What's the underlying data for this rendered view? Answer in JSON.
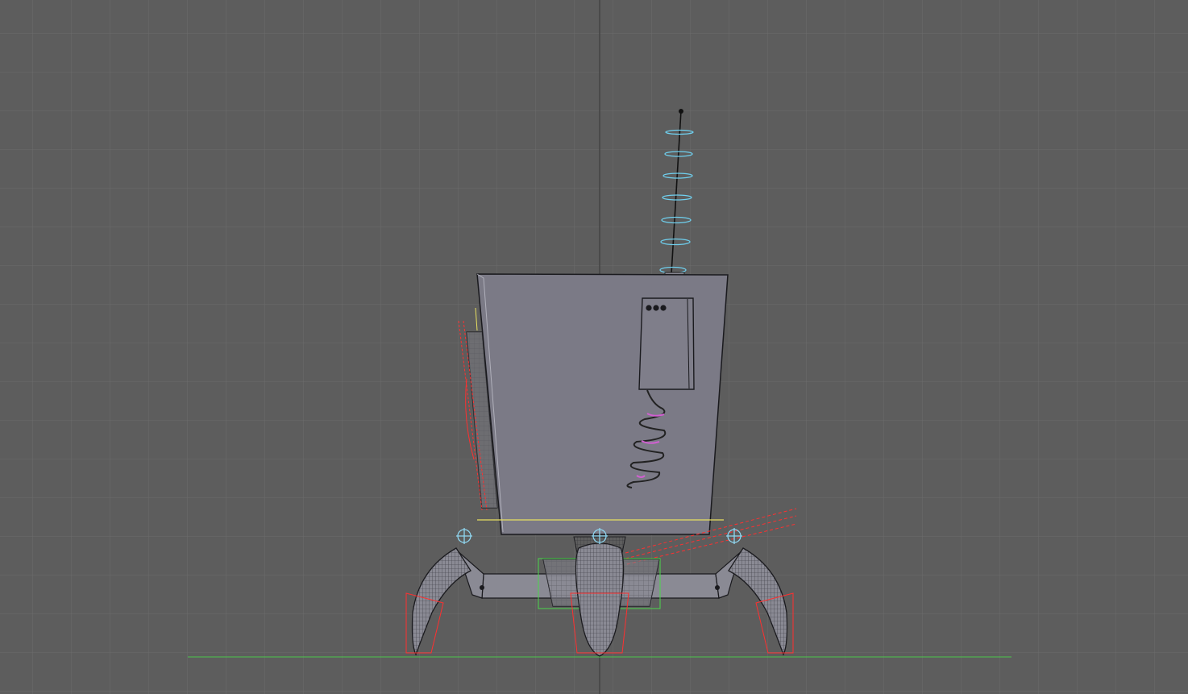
{
  "viewport": {
    "name": "3d-viewport-front-orthographic",
    "background": "#5d5d5d",
    "grid_color": "#6b6b6b",
    "axis_color": "#4a4a4a",
    "ground_line_color": "#4cc84c"
  },
  "scene": {
    "objects": [
      {
        "name": "robot-body",
        "kind": "tapered box mesh",
        "color": "#7b7a86"
      },
      {
        "name": "antenna",
        "kind": "wire with ring control curves",
        "color": "#6fd0ef"
      },
      {
        "name": "control-box",
        "kind": "box with three buttons",
        "color": "#7b7a86"
      },
      {
        "name": "coil-spring",
        "kind": "helix wire",
        "color": "#d060d0"
      },
      {
        "name": "side-gear",
        "kind": "cylinder mesh",
        "color": "#7a7a82"
      },
      {
        "name": "hip-joint",
        "kind": "torus + cone mesh",
        "color": "#8a8a94"
      },
      {
        "name": "left-claw",
        "kind": "curved cone mesh",
        "color": "#8a8a94"
      },
      {
        "name": "right-claw",
        "kind": "curved cone mesh",
        "color": "#8a8a94"
      },
      {
        "name": "center-claw",
        "kind": "cone mesh",
        "color": "#8a8a94"
      }
    ],
    "selection_color": "#ff3030",
    "empty_marker_color": "#8fd6f0",
    "bounding_box_color": "#4cd64c",
    "highlight_line_color": "#e8e060"
  }
}
